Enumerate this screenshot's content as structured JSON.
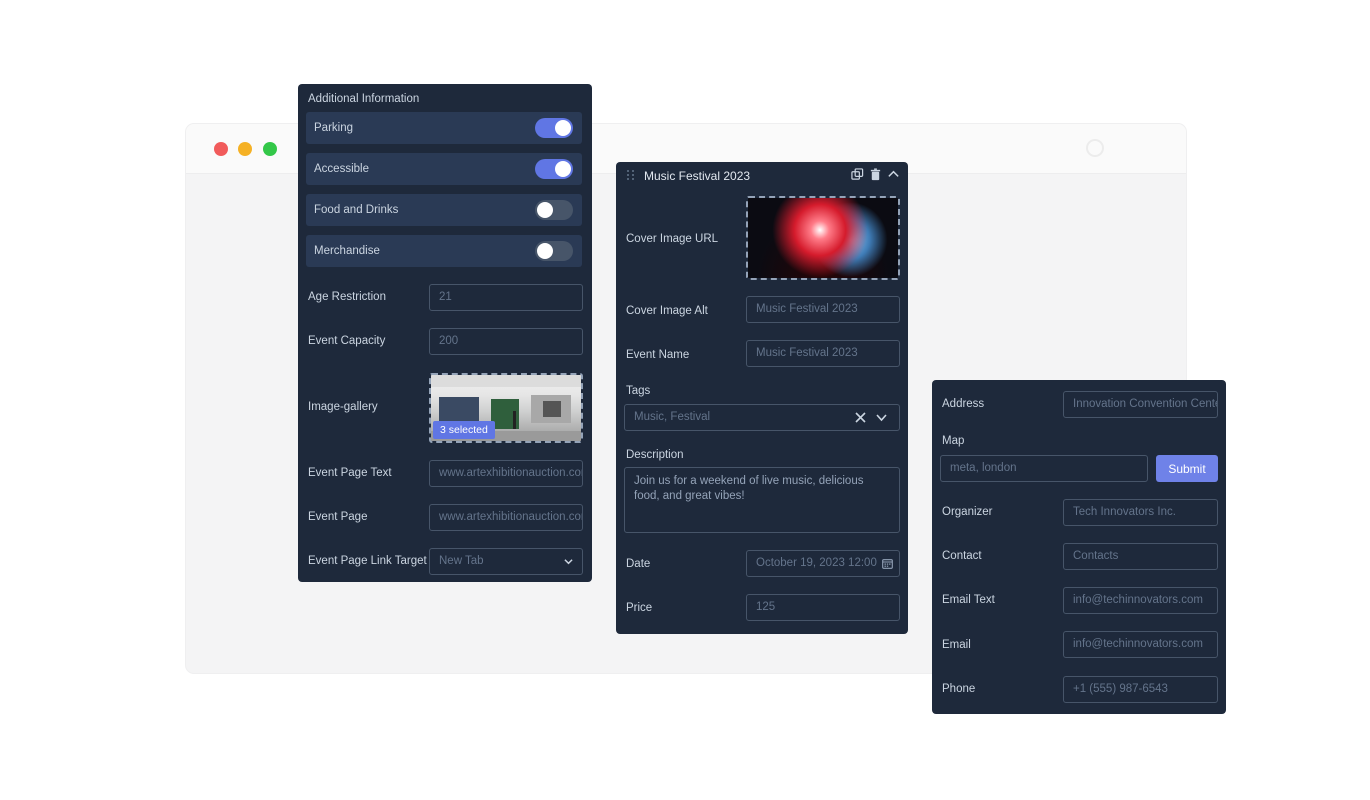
{
  "additional": {
    "title": "Additional Information",
    "toggles": [
      {
        "label": "Parking",
        "on": true
      },
      {
        "label": "Accessible",
        "on": true
      },
      {
        "label": "Food and Drinks",
        "on": false
      },
      {
        "label": "Merchandise",
        "on": false
      }
    ],
    "age_restriction": {
      "label": "Age Restriction",
      "value": "21"
    },
    "event_capacity": {
      "label": "Event Capacity",
      "value": "200"
    },
    "image_gallery": {
      "label": "Image-gallery",
      "badge": "3 selected"
    },
    "event_page_text": {
      "label": "Event Page Text",
      "value": "www.artexhibitionauction.com"
    },
    "event_page": {
      "label": "Event Page",
      "value": "www.artexhibitionauction.com"
    },
    "link_target": {
      "label": "Event Page Link Target",
      "value": "New Tab"
    }
  },
  "event": {
    "title": "Music Festival 2023",
    "cover_url_label": "Cover Image URL",
    "cover_alt": {
      "label": "Cover Image Alt",
      "value": "Music Festival 2023"
    },
    "event_name": {
      "label": "Event Name",
      "value": "Music Festival 2023"
    },
    "tags": {
      "label": "Tags",
      "value": "Music, Festival"
    },
    "description": {
      "label": "Description",
      "value": "Join us for a weekend of live music, delicious food, and great vibes!"
    },
    "date": {
      "label": "Date",
      "value": "October 19, 2023 12:00"
    },
    "price": {
      "label": "Price",
      "value": "125"
    }
  },
  "location": {
    "address": {
      "label": "Address",
      "value": "Innovation Convention Center"
    },
    "map": {
      "label": "Map",
      "value": "meta, london",
      "submit": "Submit"
    },
    "organizer": {
      "label": "Organizer",
      "value": "Tech Innovators Inc."
    },
    "contact": {
      "label": "Contact",
      "placeholder": "Contacts"
    },
    "email_text": {
      "label": "Email Text",
      "value": "info@techinnovators.com"
    },
    "email": {
      "label": "Email",
      "value": "info@techinnovators.com"
    },
    "phone": {
      "label": "Phone",
      "value": "+1 (555) 987-6543"
    }
  },
  "colors": {
    "panel": "#1e293b",
    "accent": "#6076e4",
    "row": "#2a3a55"
  }
}
